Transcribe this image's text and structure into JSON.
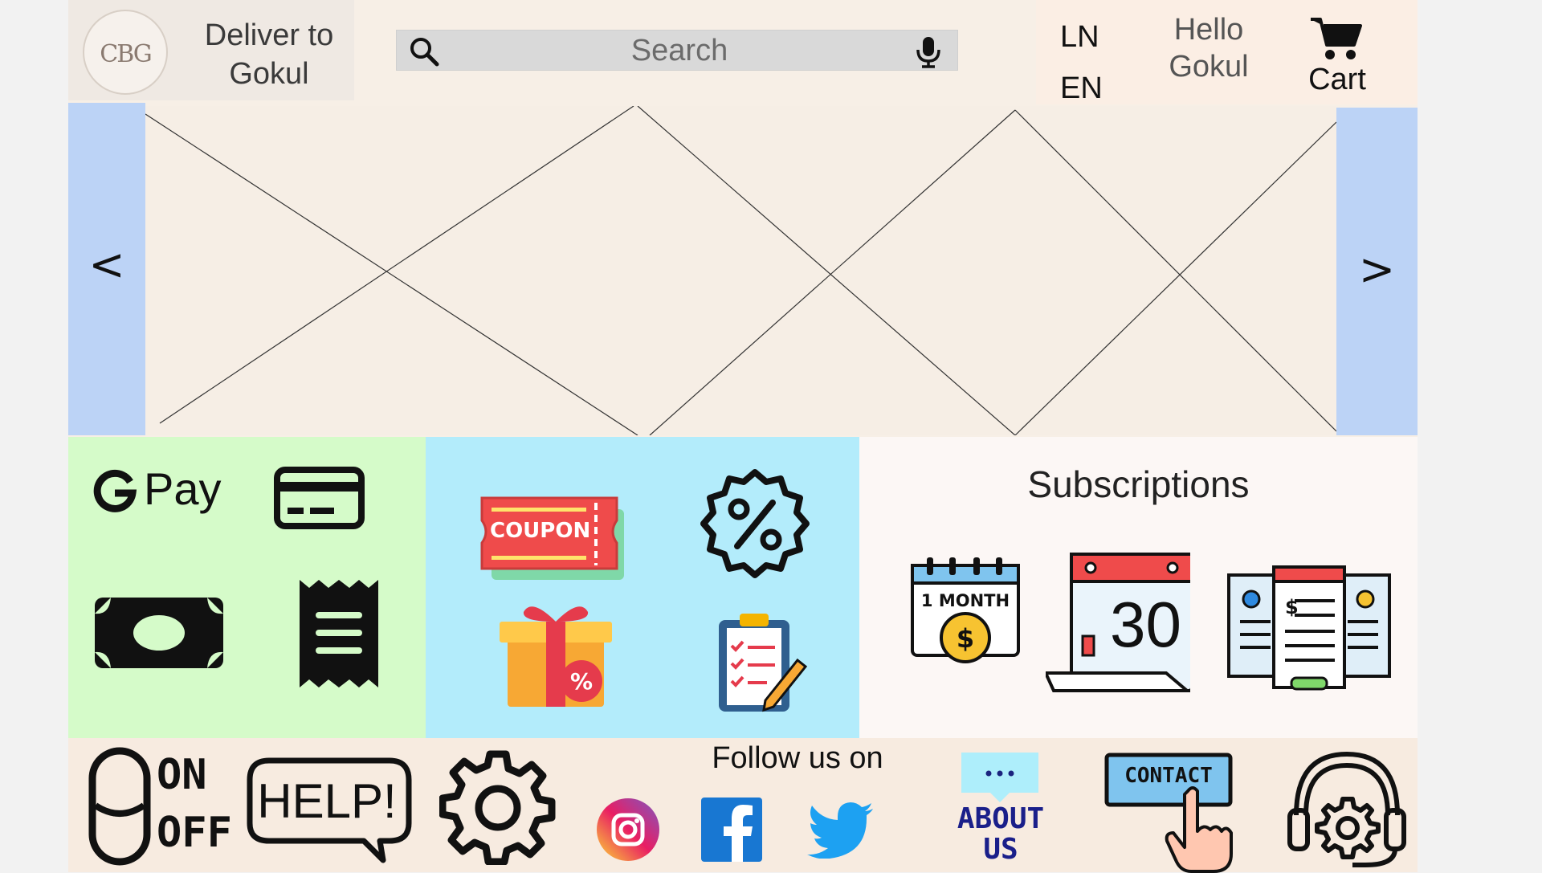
{
  "header": {
    "logo_text": "CBG",
    "deliver_line1": "Deliver to",
    "deliver_line2": "Gokul",
    "search_placeholder": "Search",
    "lang_line1": "LN",
    "lang_line2": "EN",
    "hello_line1": "Hello",
    "hello_line2": "Gokul",
    "cart_label": "Cart"
  },
  "banner": {
    "prev": "<",
    "next": ">"
  },
  "payments": {
    "gpay_label": "Pay"
  },
  "deals": {
    "coupon_label": "COUPON"
  },
  "subscriptions": {
    "title": "Subscriptions",
    "calendar_label": "1 MONTH",
    "day_number": "30"
  },
  "footer": {
    "follow_label": "Follow us on",
    "on_label": "ON",
    "off_label": "OFF",
    "help_label": "HELP!",
    "about_line1": "ABOUT",
    "about_line2": "US",
    "contact_label": "CONTACT"
  }
}
